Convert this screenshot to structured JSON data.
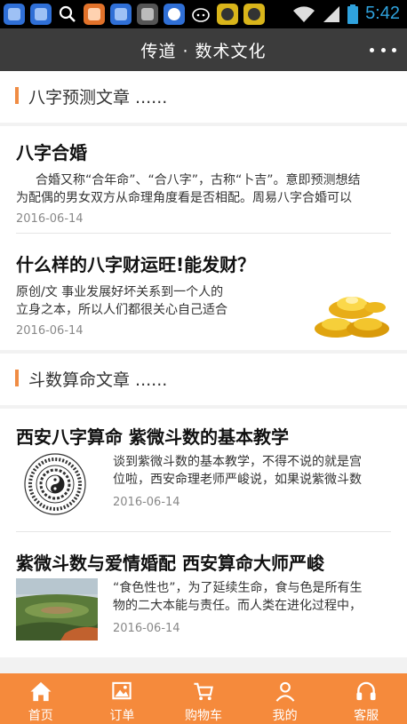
{
  "status_bar": {
    "time": "5:42"
  },
  "header": {
    "title": "传道 · 数术文化"
  },
  "sections": [
    {
      "title": "八字预测文章 ......",
      "articles": [
        {
          "title": "八字合婚",
          "desc_line1": "合婚又称“合年命”、“合八字”，古称“卜吉”。意即预测想结",
          "desc_line2": "为配偶的男女双方从命理角度看是否相配。周易八字合婚可以",
          "date": "2016-06-14"
        },
        {
          "title": "什么样的八字财运旺!能发财？",
          "desc_line1": "原创/文 事业发展好坏关系到一个人的",
          "desc_line2": "立身之本，所以人们都很关心自己适合",
          "date": "2016-06-14"
        }
      ]
    },
    {
      "title": "斗数算命文章 ......",
      "articles": [
        {
          "title": "西安八字算命 紫微斗数的基本教学",
          "desc_line1": "谈到紫微斗数的基本教学，不得不说的就是宫",
          "desc_line2": "位啦，西安命理老师严峻说，如果说紫微斗数",
          "date": "2016-06-14"
        },
        {
          "title": "紫微斗数与爱情婚配 西安算命大师严峻",
          "desc_line1": "“食色性也”，为了延续生命，食与色是所有生",
          "desc_line2": "物的二大本能与责任。而人类在进化过程中，",
          "date": "2016-06-14"
        }
      ]
    }
  ],
  "tabbar": [
    {
      "label": "首页",
      "icon": "home-icon"
    },
    {
      "label": "订单",
      "icon": "image-icon"
    },
    {
      "label": "购物车",
      "icon": "cart-icon"
    },
    {
      "label": "我的",
      "icon": "user-icon"
    },
    {
      "label": "客服",
      "icon": "headset-icon"
    }
  ],
  "colors": {
    "accent": "#f58a3c",
    "header_bg": "#3c3c3c",
    "status_time": "#2fa2dd"
  }
}
